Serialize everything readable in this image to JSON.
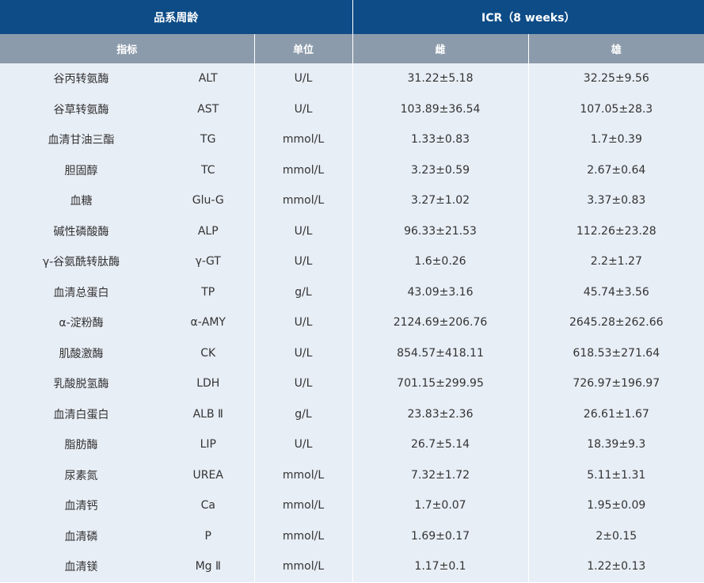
{
  "header": {
    "strain_age": "品系周龄",
    "strain_value": "ICR（8 weeks）"
  },
  "subheader": {
    "indicator": "指标",
    "unit": "单位",
    "female": "雌",
    "male": "雄"
  },
  "rows": [
    {
      "name": "谷丙转氨酶",
      "abbr": "ALT",
      "unit": "U/L",
      "female": "31.22±5.18",
      "male": "32.25±9.56"
    },
    {
      "name": "谷草转氨酶",
      "abbr": "AST",
      "unit": "U/L",
      "female": "103.89±36.54",
      "male": "107.05±28.3"
    },
    {
      "name": "血清甘油三酯",
      "abbr": "TG",
      "unit": "mmol/L",
      "female": "1.33±0.83",
      "male": "1.7±0.39"
    },
    {
      "name": "胆固醇",
      "abbr": "TC",
      "unit": "mmol/L",
      "female": "3.23±0.59",
      "male": "2.67±0.64"
    },
    {
      "name": "血糖",
      "abbr": "Glu-G",
      "unit": "mmol/L",
      "female": "3.27±1.02",
      "male": "3.37±0.83"
    },
    {
      "name": "碱性磷酸酶",
      "abbr": "ALP",
      "unit": "U/L",
      "female": "96.33±21.53",
      "male": "112.26±23.28"
    },
    {
      "name": "γ-谷氨酰转肽酶",
      "abbr": "γ-GT",
      "unit": "U/L",
      "female": "1.6±0.26",
      "male": "2.2±1.27"
    },
    {
      "name": "血清总蛋白",
      "abbr": "TP",
      "unit": "g/L",
      "female": "43.09±3.16",
      "male": "45.74±3.56"
    },
    {
      "name": "α-淀粉酶",
      "abbr": "α-AMY",
      "unit": "U/L",
      "female": "2124.69±206.76",
      "male": "2645.28±262.66"
    },
    {
      "name": "肌酸激酶",
      "abbr": "CK",
      "unit": "U/L",
      "female": "854.57±418.11",
      "male": "618.53±271.64"
    },
    {
      "name": "乳酸脱氢酶",
      "abbr": "LDH",
      "unit": "U/L",
      "female": "701.15±299.95",
      "male": "726.97±196.97"
    },
    {
      "name": "血清白蛋白",
      "abbr": "ALB Ⅱ",
      "unit": "g/L",
      "female": "23.83±2.36",
      "male": "26.61±1.67"
    },
    {
      "name": "脂肪酶",
      "abbr": "LIP",
      "unit": "U/L",
      "female": "26.7±5.14",
      "male": "18.39±9.3"
    },
    {
      "name": "尿素氮",
      "abbr": "UREA",
      "unit": "mmol/L",
      "female": "7.32±1.72",
      "male": "5.11±1.31"
    },
    {
      "name": "血清钙",
      "abbr": "Ca",
      "unit": "mmol/L",
      "female": "1.7±0.07",
      "male": "1.95±0.09"
    },
    {
      "name": "血清磷",
      "abbr": "P",
      "unit": "mmol/L",
      "female": "1.69±0.17",
      "male": "2±0.15"
    },
    {
      "name": "血清镁",
      "abbr": "Mg Ⅱ",
      "unit": "mmol/L",
      "female": "1.17±0.1",
      "male": "1.22±0.13"
    }
  ]
}
